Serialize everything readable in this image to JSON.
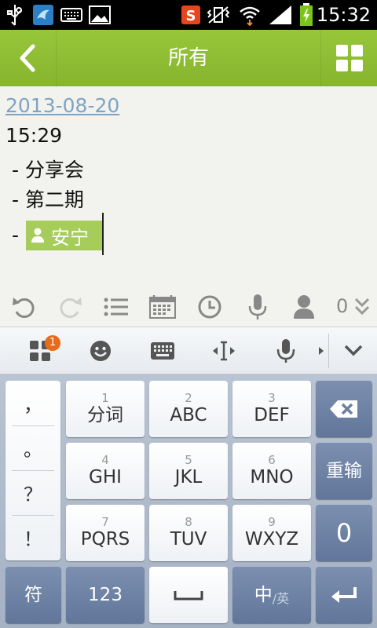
{
  "status_bar": {
    "time": "15:32",
    "icons": [
      "usb-icon",
      "app-bird-icon",
      "keyboard-icon",
      "image-icon",
      "sogou-icon",
      "vibrate-icon",
      "wifi-icon",
      "signal-icon",
      "battery-icon"
    ]
  },
  "title_bar": {
    "title": "所有"
  },
  "note": {
    "date": "2013-08-20",
    "time": "15:29",
    "lines": [
      " - 分享会",
      " - 第二期",
      " - "
    ],
    "contact_chip": "安宁"
  },
  "note_toolbar": {
    "count": "0",
    "icons": [
      "undo-icon",
      "redo-icon",
      "list-icon",
      "calendar-icon",
      "clock-icon",
      "mic-icon",
      "contact-icon",
      "expand-icon"
    ]
  },
  "candidate_bar": {
    "badge": "1",
    "icons": [
      "apps-icon",
      "emoji-icon",
      "keyboard-icon",
      "cursor-move-icon",
      "voice-icon",
      "collapse-keyboard-icon"
    ]
  },
  "keyboard": {
    "punctuation": [
      "，",
      "。",
      "？",
      "！"
    ],
    "keys": [
      {
        "num": "1",
        "label": "分词"
      },
      {
        "num": "2",
        "label": "ABC"
      },
      {
        "num": "3",
        "label": "DEF"
      },
      {
        "num": "4",
        "label": "GHI"
      },
      {
        "num": "5",
        "label": "JKL"
      },
      {
        "num": "6",
        "label": "MNO"
      },
      {
        "num": "7",
        "label": "PQRS"
      },
      {
        "num": "8",
        "label": "TUV"
      },
      {
        "num": "9",
        "label": "WXYZ"
      }
    ],
    "reenter": "重输",
    "zero": "0",
    "symbol": "符",
    "numeric": "123",
    "lang_main": "中",
    "lang_alt": "/英",
    "colors": {
      "accent": "#8bbb31",
      "dark_key": "#6b7fa3",
      "light_key": "#ffffff"
    }
  }
}
